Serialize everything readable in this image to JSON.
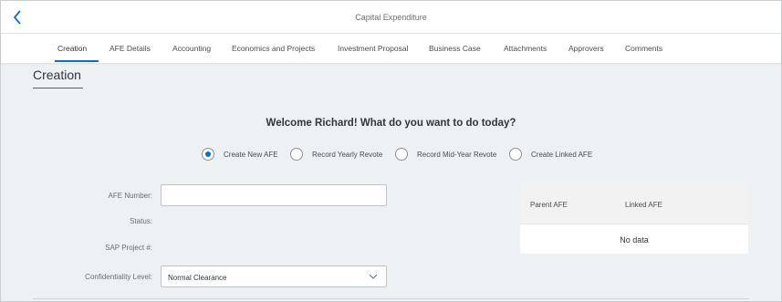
{
  "header": {
    "back_icon": "chevron-left-icon",
    "title": "Capital Expenditure"
  },
  "tabs": [
    {
      "label": "Creation",
      "active": true
    },
    {
      "label": "AFE Details",
      "active": false
    },
    {
      "label": "Accounting",
      "active": false
    },
    {
      "label": "Economics and Projects",
      "active": false
    },
    {
      "label": "Investment Proposal",
      "active": false
    },
    {
      "label": "Business Case",
      "active": false
    },
    {
      "label": "Attachments",
      "active": false
    },
    {
      "label": "Approvers",
      "active": false
    },
    {
      "label": "Comments",
      "active": false
    }
  ],
  "section": {
    "title": "Creation"
  },
  "welcome": "Welcome Richard! What do you want to do today?",
  "options": [
    {
      "label": "Create New AFE",
      "selected": true
    },
    {
      "label": "Record Yearly Revote",
      "selected": false
    },
    {
      "label": "Record Mid-Year Revote",
      "selected": false
    },
    {
      "label": "Create Linked AFE",
      "selected": false
    }
  ],
  "form": {
    "afe_number_label": "AFE Number:",
    "afe_number_value": "",
    "status_label": "Status:",
    "sap_project_label": "SAP Project #:",
    "confidentiality_label": "Confidentiality Level:",
    "confidentiality_value": "Normal Clearance"
  },
  "linked_table": {
    "col_parent": "Parent AFE",
    "col_linked": "Linked AFE",
    "empty_text": "No data"
  },
  "colors": {
    "accent": "#0a6ed1",
    "background": "#eef1f3"
  }
}
